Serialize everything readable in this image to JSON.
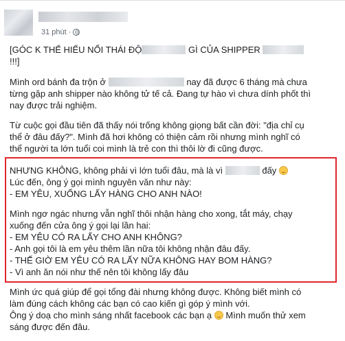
{
  "post": {
    "time": "31 phút ·",
    "title_a": "[GÓC K THỂ HIỂU NỔI THÁI ĐỘ",
    "title_b": "GÌ CỦA SHIPPER",
    "title_c": "!!!]",
    "p1_a": "Mình ord bánh đa trộn ở",
    "p1_b": "nay đã được 6 tháng mà chưa",
    "p1_c": "từng gặp anh shipper nào không tử tế cả. Đang tự hào vì chưa dính phốt thì",
    "p1_d": "nay được trải nghiệm.",
    "p2_a": "Từ cuộc gọi đầu tiên đã thấy nói trống không giọng bất cần đời: \"địa chỉ cụ",
    "p2_b": "thể ở đâu đấy?\". Mình đã hơi không có thiện cảm rồi nhưng mình nghĩ có",
    "p2_c": "thể người ta lớn tuổi coi mình là trẻ con thì thôi lờ đi cũng được.",
    "b1_a": "NHƯNG KHÔNG, không phải vì lớn tuổi đâu, mà là vì",
    "b1_b": "đấy",
    "b1_c": "Lúc đến, ông ý gọi mình nguyên văn như này:",
    "b1_d": "- EM YÊU, XUỐNG LẤY HÀNG CHO ANH NÀO!",
    "b2_a": "Mình ngơ ngác nhưng vẫn nghĩ thôi nhận hàng cho xong, tắt máy, chạy",
    "b2_b": "xuống đến cửa ông ý gọi lại lần hai:",
    "b2_c": "- EM YÊU CÓ RA LẤY CHO ANH KHÔNG?",
    "b2_d": "- Anh gọi tôi là em yêu thêm lần nữa tôi không nhận đâu đấy.",
    "b2_e": "- THẾ GIỜ EM YÊU CÓ RA LẤY NỮA KHÔNG HAY BOM HÀNG?",
    "b2_f": "- Vì anh ăn nói như thế nên tôi không lấy đâu",
    "p3_a": "Mình ức quá giúp để gọi tổng đài nhưng không được. Không biết mình có",
    "p3_b": "làm đúng cách không các bạn có cao kiến gì góp ý mình với.",
    "p3_c": "Ông ý doạ cho mình sáng nhất facebook các bạn ạ",
    "p3_d": "Mình muốn thử xem",
    "p3_e": "sáng được đến đâu."
  }
}
